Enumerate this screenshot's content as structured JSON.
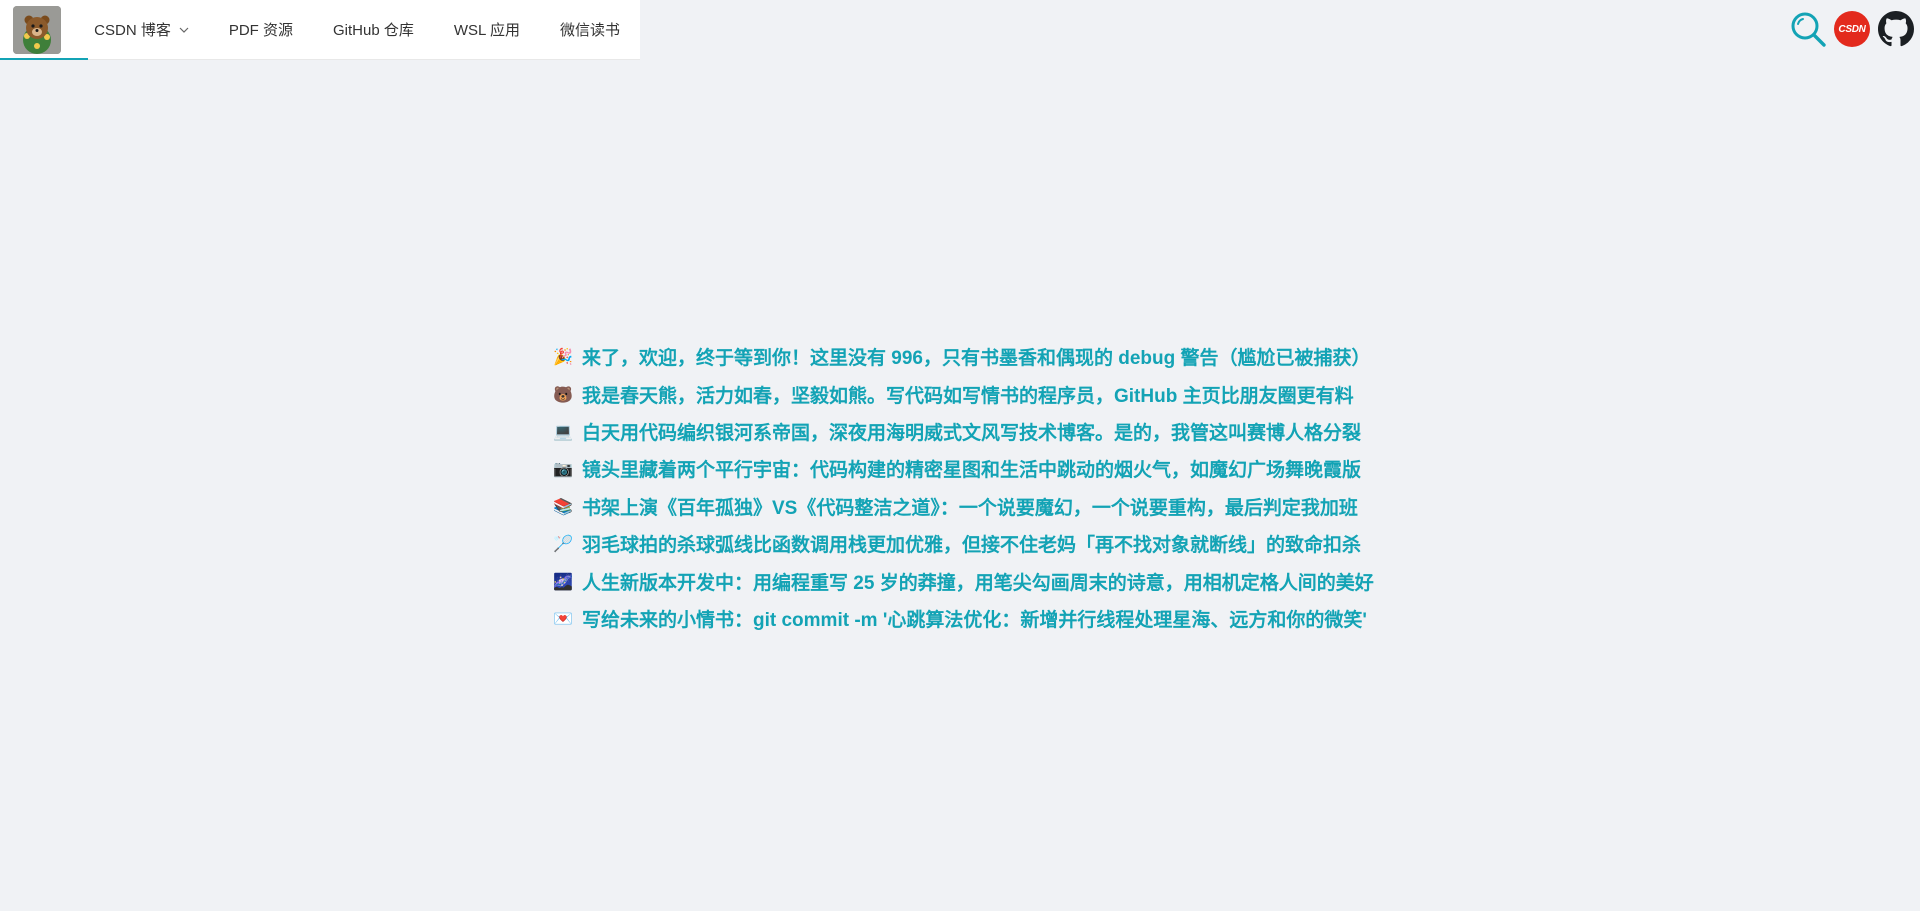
{
  "nav": {
    "items": [
      {
        "label": "CSDN 博客",
        "has_dropdown": true
      },
      {
        "label": "PDF 资源"
      },
      {
        "label": "GitHub 仓库"
      },
      {
        "label": "WSL 应用"
      },
      {
        "label": "微信读书"
      }
    ],
    "csdn_badge": "CSDN",
    "active_color": "#13a3b5"
  },
  "intro": {
    "lines": [
      {
        "emoji": "🎉",
        "text": "来了，欢迎，终于等到你！这里没有 996，只有书墨香和偶现的 debug 警告（尴尬已被捕获）"
      },
      {
        "emoji": "🐻",
        "text": "我是春天熊，活力如春，坚毅如熊。写代码如写情书的程序员，GitHub 主页比朋友圈更有料"
      },
      {
        "emoji": "💻",
        "text": "白天用代码编织银河系帝国，深夜用海明威式文风写技术博客。是的，我管这叫赛博人格分裂"
      },
      {
        "emoji": "📷",
        "text": "镜头里藏着两个平行宇宙：代码构建的精密星图和生活中跳动的烟火气，如魔幻广场舞晚霞版"
      },
      {
        "emoji": "📚",
        "text": "书架上演《百年孤独》VS《代码整洁之道》：一个说要魔幻，一个说要重构，最后判定我加班"
      },
      {
        "emoji": "🏸",
        "text": "羽毛球拍的杀球弧线比函数调用栈更加优雅，但接不住老妈「再不找对象就断线」的致命扣杀"
      },
      {
        "emoji": "🌌",
        "text": "人生新版本开发中：用编程重写 25 岁的莽撞，用笔尖勾画周末的诗意，用相机定格人间的美好"
      },
      {
        "emoji": "💌",
        "text": "写给未来的小情书：git commit -m '心跳算法优化：新增并行线程处理星海、远方和你的微笑'"
      }
    ],
    "text_color": "#13a3b5"
  },
  "icons": [
    "avatar-logo",
    "chevron-down-icon",
    "search-icon",
    "csdn-icon",
    "github-icon"
  ]
}
